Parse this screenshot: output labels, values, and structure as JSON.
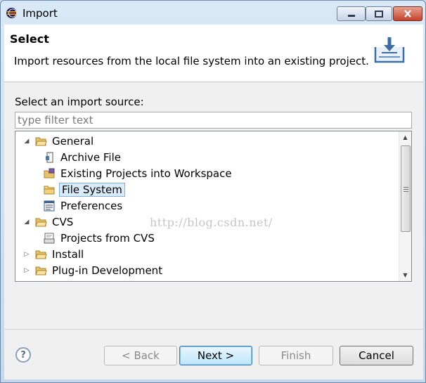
{
  "window": {
    "title": "Import"
  },
  "header": {
    "title": "Select",
    "description": "Import resources from the local file system into an existing project."
  },
  "source": {
    "label": "Select an import source:",
    "filter_placeholder": "type filter text",
    "filter_value": ""
  },
  "tree": [
    {
      "label": "General",
      "level": 0,
      "expanded": true,
      "icon": "folder-open-icon"
    },
    {
      "label": "Archive File",
      "level": 1,
      "icon": "archive-file-icon"
    },
    {
      "label": "Existing Projects into Workspace",
      "level": 1,
      "icon": "existing-projects-icon"
    },
    {
      "label": "File System",
      "level": 1,
      "icon": "folder-icon",
      "selected": true
    },
    {
      "label": "Preferences",
      "level": 1,
      "icon": "preferences-icon"
    },
    {
      "label": "CVS",
      "level": 0,
      "expanded": true,
      "icon": "folder-open-icon"
    },
    {
      "label": "Projects from CVS",
      "level": 1,
      "icon": "cvs-projects-icon"
    },
    {
      "label": "Install",
      "level": 0,
      "expanded": false,
      "icon": "folder-icon"
    },
    {
      "label": "Plug-in Development",
      "level": 0,
      "expanded": false,
      "icon": "folder-icon"
    }
  ],
  "watermark": "http://blog.csdn.net/",
  "buttons": {
    "back": "< Back",
    "next": "Next >",
    "finish": "Finish",
    "cancel": "Cancel"
  },
  "colors": {
    "selection": "#d9ebf9",
    "default_button": "#bee6fd",
    "close_button": "#c5432c"
  }
}
